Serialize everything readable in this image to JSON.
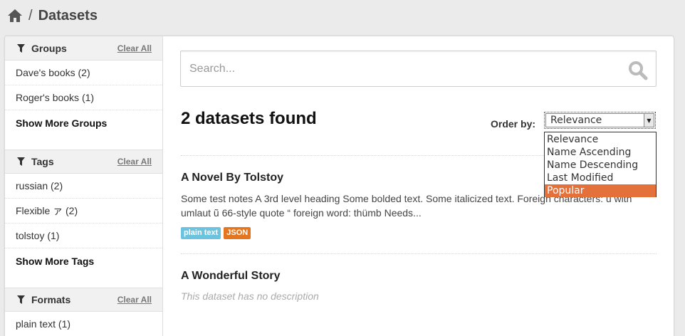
{
  "breadcrumb": {
    "separator": "/",
    "current": "Datasets"
  },
  "sidebar": {
    "facets": [
      {
        "title": "Groups",
        "clear_label": "Clear All",
        "items": [
          "Dave's books (2)",
          "Roger's books (1)"
        ],
        "more_label": "Show More Groups"
      },
      {
        "title": "Tags",
        "clear_label": "Clear All",
        "items": [
          "russian (2)",
          "Flexible ァ (2)",
          "tolstoy (1)"
        ],
        "more_label": "Show More Tags"
      },
      {
        "title": "Formats",
        "clear_label": "Clear All",
        "items": [
          "plain text (1)"
        ]
      }
    ]
  },
  "search": {
    "placeholder": "Search...",
    "value": ""
  },
  "results": {
    "count_label": "2 datasets found"
  },
  "order": {
    "label": "Order by:",
    "selected": "Relevance",
    "options": [
      "Relevance",
      "Name Ascending",
      "Name Descending",
      "Last Modified",
      "Popular"
    ],
    "highlighted": "Popular"
  },
  "datasets": [
    {
      "title": "A Novel By Tolstoy",
      "notes": "Some test notes A 3rd level heading Some bolded text. Some italicized text. Foreign characters: ü with umlaut ũ 66-style quote “ foreign word: thümb Needs...",
      "formats": [
        {
          "label": "plain text",
          "color": "#6cc3e0"
        },
        {
          "label": "JSON",
          "color": "#e3761f"
        }
      ]
    },
    {
      "title": "A Wonderful Story",
      "empty_note": "This dataset has no description"
    }
  ],
  "colors": {
    "accent": "#e4703a",
    "tag_plain_text": "#6cc3e0",
    "tag_json": "#e3761f"
  }
}
